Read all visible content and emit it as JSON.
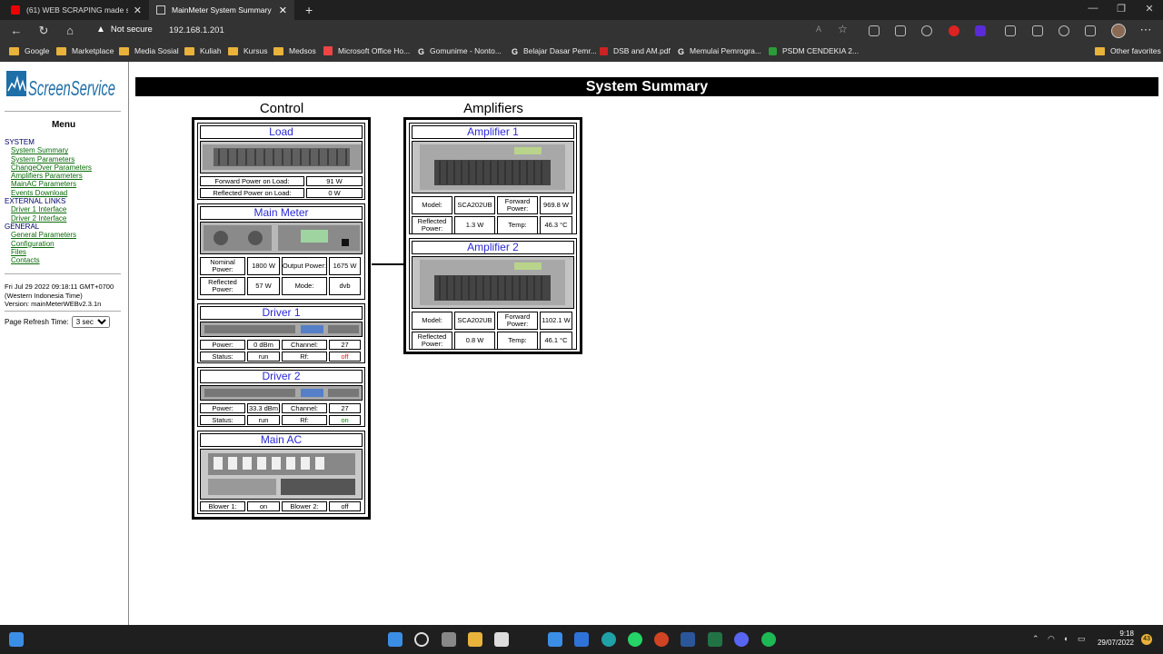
{
  "browser": {
    "tabs": [
      {
        "title": "(61) WEB SCRAPING made simpl",
        "active": false
      },
      {
        "title": "MainMeter System Summary",
        "active": true
      }
    ],
    "security": "Not secure",
    "url": "192.168.1.201",
    "bookmarks": [
      "Google",
      "Marketplace",
      "Media Sosial",
      "Kuliah",
      "Kursus",
      "Medsos",
      "Microsoft Office Ho...",
      "Gomunime - Nonto...",
      "Belajar Dasar Pemr...",
      "DSB and AM.pdf",
      "Memulai Pemrogra...",
      "PSDM CENDEKIA 2..."
    ],
    "other_favorites": "Other favorites"
  },
  "sidebar": {
    "logo_text": "ScreenService",
    "menu_title": "Menu",
    "groups": [
      {
        "label": "SYSTEM",
        "links": [
          "System Summary",
          "System Parameters",
          "ChangeOver Parameters",
          "Amplifiers Parameters",
          "MainAC Parameters",
          "Events Download"
        ]
      },
      {
        "label": "EXTERNAL LINKS",
        "links": [
          "Driver 1 Interface",
          "Driver 2 Interface"
        ]
      },
      {
        "label": "GENERAL",
        "links": [
          "General Parameters",
          "Configuration",
          "Files",
          "Contacts"
        ]
      }
    ],
    "date_line1": "Fri Jul 29 2022 09:18:11 GMT+0700",
    "date_line2": "(Western Indonesia Time)",
    "version": "Version: mainMeterWEBv2.3.1n",
    "refresh_label": "Page Refresh Time:",
    "refresh_value": "3 sec"
  },
  "page": {
    "title": "System Summary",
    "control_heading": "Control",
    "amplifiers_heading": "Amplifiers"
  },
  "load": {
    "title": "Load",
    "fwd_label": "Forward Power on Load:",
    "fwd_value": "91 W",
    "refl_label": "Reflected Power on Load:",
    "refl_value": "0 W"
  },
  "mainmeter": {
    "title": "Main Meter",
    "nominal_label": "Nominal Power:",
    "nominal_value": "1800 W",
    "output_label": "Output Power:",
    "output_value": "1675 W",
    "refl_label": "Reflected Power:",
    "refl_value": "57 W",
    "mode_label": "Mode:",
    "mode_value": "dvb"
  },
  "driver1": {
    "title": "Driver 1",
    "power_label": "Power:",
    "power_value": "0 dBm",
    "channel_label": "Channel:",
    "channel_value": "27",
    "status_label": "Status:",
    "status_value": "run",
    "rf_label": "Rf:",
    "rf_value": "off",
    "rf_color": "#dd2222"
  },
  "driver2": {
    "title": "Driver 2",
    "power_label": "Power:",
    "power_value": "33.3 dBm",
    "channel_label": "Channel:",
    "channel_value": "27",
    "status_label": "Status:",
    "status_value": "run",
    "rf_label": "Rf:",
    "rf_value": "on",
    "rf_color": "#008800"
  },
  "mainac": {
    "title": "Main AC",
    "blower1_label": "Blower 1:",
    "blower1_value": "on",
    "blower2_label": "Blower 2:",
    "blower2_value": "off"
  },
  "amp1": {
    "title": "Amplifier 1",
    "model_label": "Model:",
    "model_value": "SCA202UB",
    "fwd_label": "Forward Power:",
    "fwd_value": "969.8 W",
    "refl_label": "Reflected Power:",
    "refl_value": "1.3 W",
    "temp_label": "Temp:",
    "temp_value": "46.3 °C"
  },
  "amp2": {
    "title": "Amplifier 2",
    "model_label": "Model:",
    "model_value": "SCA202UB",
    "fwd_label": "Forward Power:",
    "fwd_value": "1102.1 W",
    "refl_label": "Reflected Power:",
    "refl_value": "0.8 W",
    "temp_label": "Temp:",
    "temp_value": "46.1 °C"
  },
  "taskbar": {
    "time": "9:18",
    "date": "29/07/2022",
    "badge": "43"
  }
}
